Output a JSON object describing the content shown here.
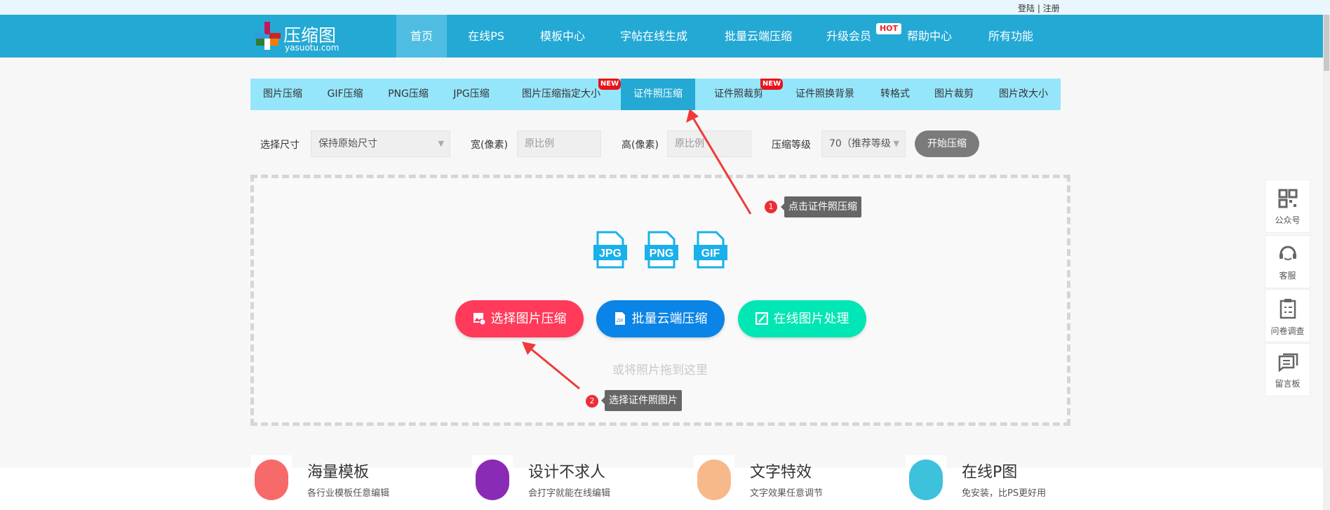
{
  "topbar": {
    "login": "登陆",
    "sep": "|",
    "register": "注册"
  },
  "logo": {
    "name": "压缩图",
    "domain": "yasuotu.com"
  },
  "nav": [
    {
      "label": "首页",
      "active": true
    },
    {
      "label": "在线PS"
    },
    {
      "label": "模板中心"
    },
    {
      "label": "字帖在线生成"
    },
    {
      "label": "批量云端压缩"
    },
    {
      "label": "升级会员",
      "badge": "HOT"
    },
    {
      "label": "帮助中心"
    },
    {
      "label": "所有功能"
    }
  ],
  "tabs": [
    {
      "label": "图片压缩"
    },
    {
      "label": "GIF压缩"
    },
    {
      "label": "PNG压缩"
    },
    {
      "label": "JPG压缩"
    },
    {
      "label": "图片压缩指定大小",
      "badge": "NEW"
    },
    {
      "label": "证件照压缩",
      "active": true
    },
    {
      "label": "证件照裁剪",
      "badge": "NEW"
    },
    {
      "label": "证件照换背景"
    },
    {
      "label": "转格式"
    },
    {
      "label": "图片裁剪"
    },
    {
      "label": "图片改大小"
    }
  ],
  "options": {
    "size_label": "选择尺寸",
    "size_value": "保持原始尺寸",
    "width_label": "宽(像素)",
    "width_placeholder": "原比例",
    "height_label": "高(像素)",
    "height_placeholder": "原比例",
    "level_label": "压缩等级",
    "level_value": "70（推荐等级）",
    "start": "开始压缩"
  },
  "upload": {
    "formats": [
      "JPG",
      "PNG",
      "GIF"
    ],
    "select_btn": "选择图片压缩",
    "batch_btn": "批量云端压缩",
    "online_btn": "在线图片处理",
    "drop_hint": "或将照片拖到这里"
  },
  "annotations": [
    {
      "num": "1",
      "text": "点击证件照压缩"
    },
    {
      "num": "2",
      "text": "选择证件照图片"
    }
  ],
  "features": [
    {
      "title": "海量模板",
      "sub": "各行业模板任意编辑",
      "color": "#f76a6a"
    },
    {
      "title": "设计不求人",
      "sub": "会打字就能在线编辑",
      "color": "#8a2bb5"
    },
    {
      "title": "文字特效",
      "sub": "文字效果任意调节",
      "color": "#f7b98a"
    },
    {
      "title": "在线P图",
      "sub": "免安装，比PS更好用",
      "color": "#3ec1dc"
    }
  ],
  "sidebar": [
    {
      "label": "公众号",
      "icon": "qr-code-icon"
    },
    {
      "label": "客服",
      "icon": "headset-icon"
    },
    {
      "label": "问卷调查",
      "icon": "clipboard-icon"
    },
    {
      "label": "留言板",
      "icon": "message-icon"
    }
  ],
  "colors": {
    "header": "#24a9d5",
    "tabs": "#96e6fb",
    "red": "#ff3a5a",
    "blue": "#0a84e6",
    "green": "#00e6b4"
  }
}
